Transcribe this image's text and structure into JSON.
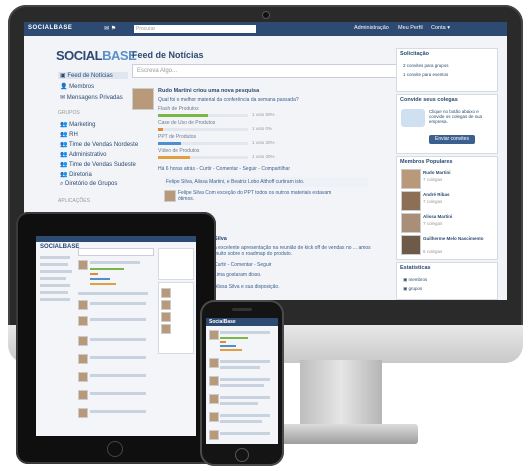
{
  "monitor": {
    "topbar": {
      "brand": "SOCIALBASE",
      "search_placeholder": "Procurar",
      "links": [
        "Administração",
        "Meu Perfil",
        "Conta ▾"
      ]
    },
    "logo": {
      "part1": "SOCIAL",
      "part2": "BASE"
    },
    "nav": [
      {
        "label": "Feed de Notícias",
        "active": true
      },
      {
        "label": "Membros"
      },
      {
        "label": "Mensagens Privadas"
      }
    ],
    "groups_label": "Grupos",
    "groups": [
      "Marketing",
      "RH",
      "Time de Vendas Nordeste",
      "Administrativo",
      "Time de Vendas Sudeste",
      "Diretoria",
      "Diretório de Grupos"
    ],
    "apps_label": "Aplicações",
    "feed": {
      "title": "Feed de Notícias",
      "status_placeholder": "Escreva Algo...",
      "post1_author": "Rudo Martini criou uma nova pesquisa",
      "post1_question": "Qual foi o melhor material da conferência da semana passada?",
      "poll": [
        {
          "label": "Flash de Produtos",
          "count": "1 voto 50%",
          "pct": 0.55,
          "color": "#7ab648"
        },
        {
          "label": "Case de Uso de Produtos",
          "count": "1 voto 0%",
          "pct": 0.05,
          "color": "#e08a3c"
        },
        {
          "label": "PPT de Produtos",
          "count": "1 voto 20%",
          "pct": 0.25,
          "color": "#4f8fd0"
        },
        {
          "label": "Vídeo de Produtos",
          "count": "1 voto 30%",
          "pct": 0.35,
          "color": "#e0a040"
        }
      ],
      "post1_meta": "Há 6 horas atrás - Curtir - Comentar - Seguir - Compartilhar",
      "post2_likes": "Felipe Silva, Alissa Martini, e Beatriz Lobo Althoff curtiram isto.",
      "post2_comment": "Felipe Silva Com exceção do PPT todos os outros materiais estavam ótimos.",
      "post3_partial": "Silva",
      "post3_text": "a excelente apresentação na reunião de kick off de vendas no ... amos muito sobre o roadmap do produto.",
      "post3_meta": "Curtir - Comentar - Seguir",
      "post3_likes": "Lima gostaram disso.",
      "post3_more": "Alissa Silva e sua disposição."
    },
    "right": {
      "invite_head": "Solicitação",
      "invite_lines": [
        "2 convites para grupos",
        "1 convite para eventos"
      ],
      "colleagues_head": "Convide seus colegas",
      "colleagues_text": "Clique no botão abaixo e convide os colegas de sua empresa.",
      "colleagues_button": "Enviar convites",
      "popular_head": "Membros Populares",
      "members": [
        {
          "name": "Rudo Martini",
          "meta": "7 colegas"
        },
        {
          "name": "André Ribas",
          "meta": "7 colegas"
        },
        {
          "name": "Alissa Martini",
          "meta": "7 colegas"
        },
        {
          "name": "Guilherme Melo Nascimento",
          "meta": "6 colegas"
        }
      ],
      "stats_head": "Estatísticas",
      "stats": [
        "membros",
        "grupos"
      ]
    }
  },
  "ipad": {
    "brand": "SOCIALBASE"
  },
  "iphone": {
    "brand": "SocialBase"
  }
}
